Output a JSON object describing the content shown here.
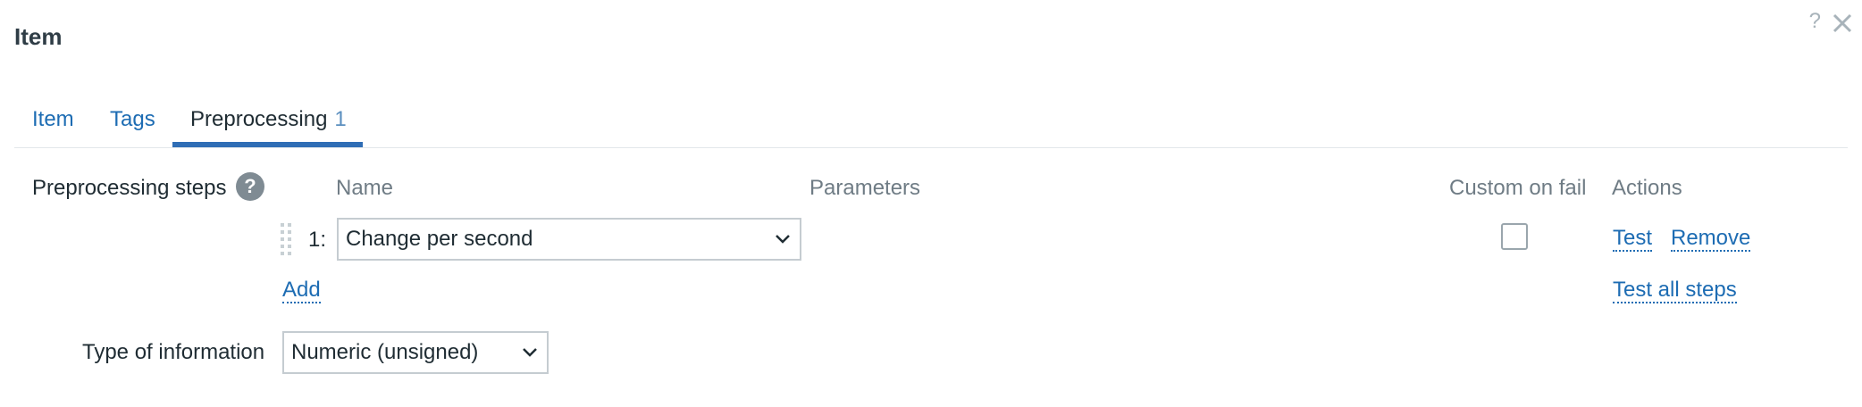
{
  "dialog": {
    "title": "Item",
    "help_icon": "question-mark-icon",
    "close_icon": "close-icon"
  },
  "tabs": [
    {
      "label": "Item"
    },
    {
      "label": "Tags"
    },
    {
      "label": "Preprocessing",
      "count": "1",
      "active": true
    }
  ],
  "preprocessing": {
    "label": "Preprocessing steps",
    "help_glyph": "?",
    "columns": {
      "name": "Name",
      "parameters": "Parameters",
      "custom_on_fail": "Custom on fail",
      "actions": "Actions"
    },
    "steps": [
      {
        "number": "1:",
        "name": "Change per second",
        "custom_on_fail": false,
        "actions": {
          "test": "Test",
          "remove": "Remove"
        }
      }
    ],
    "add_label": "Add",
    "test_all_label": "Test all steps"
  },
  "type_of_information": {
    "label": "Type of information",
    "value": "Numeric (unsigned)"
  }
}
